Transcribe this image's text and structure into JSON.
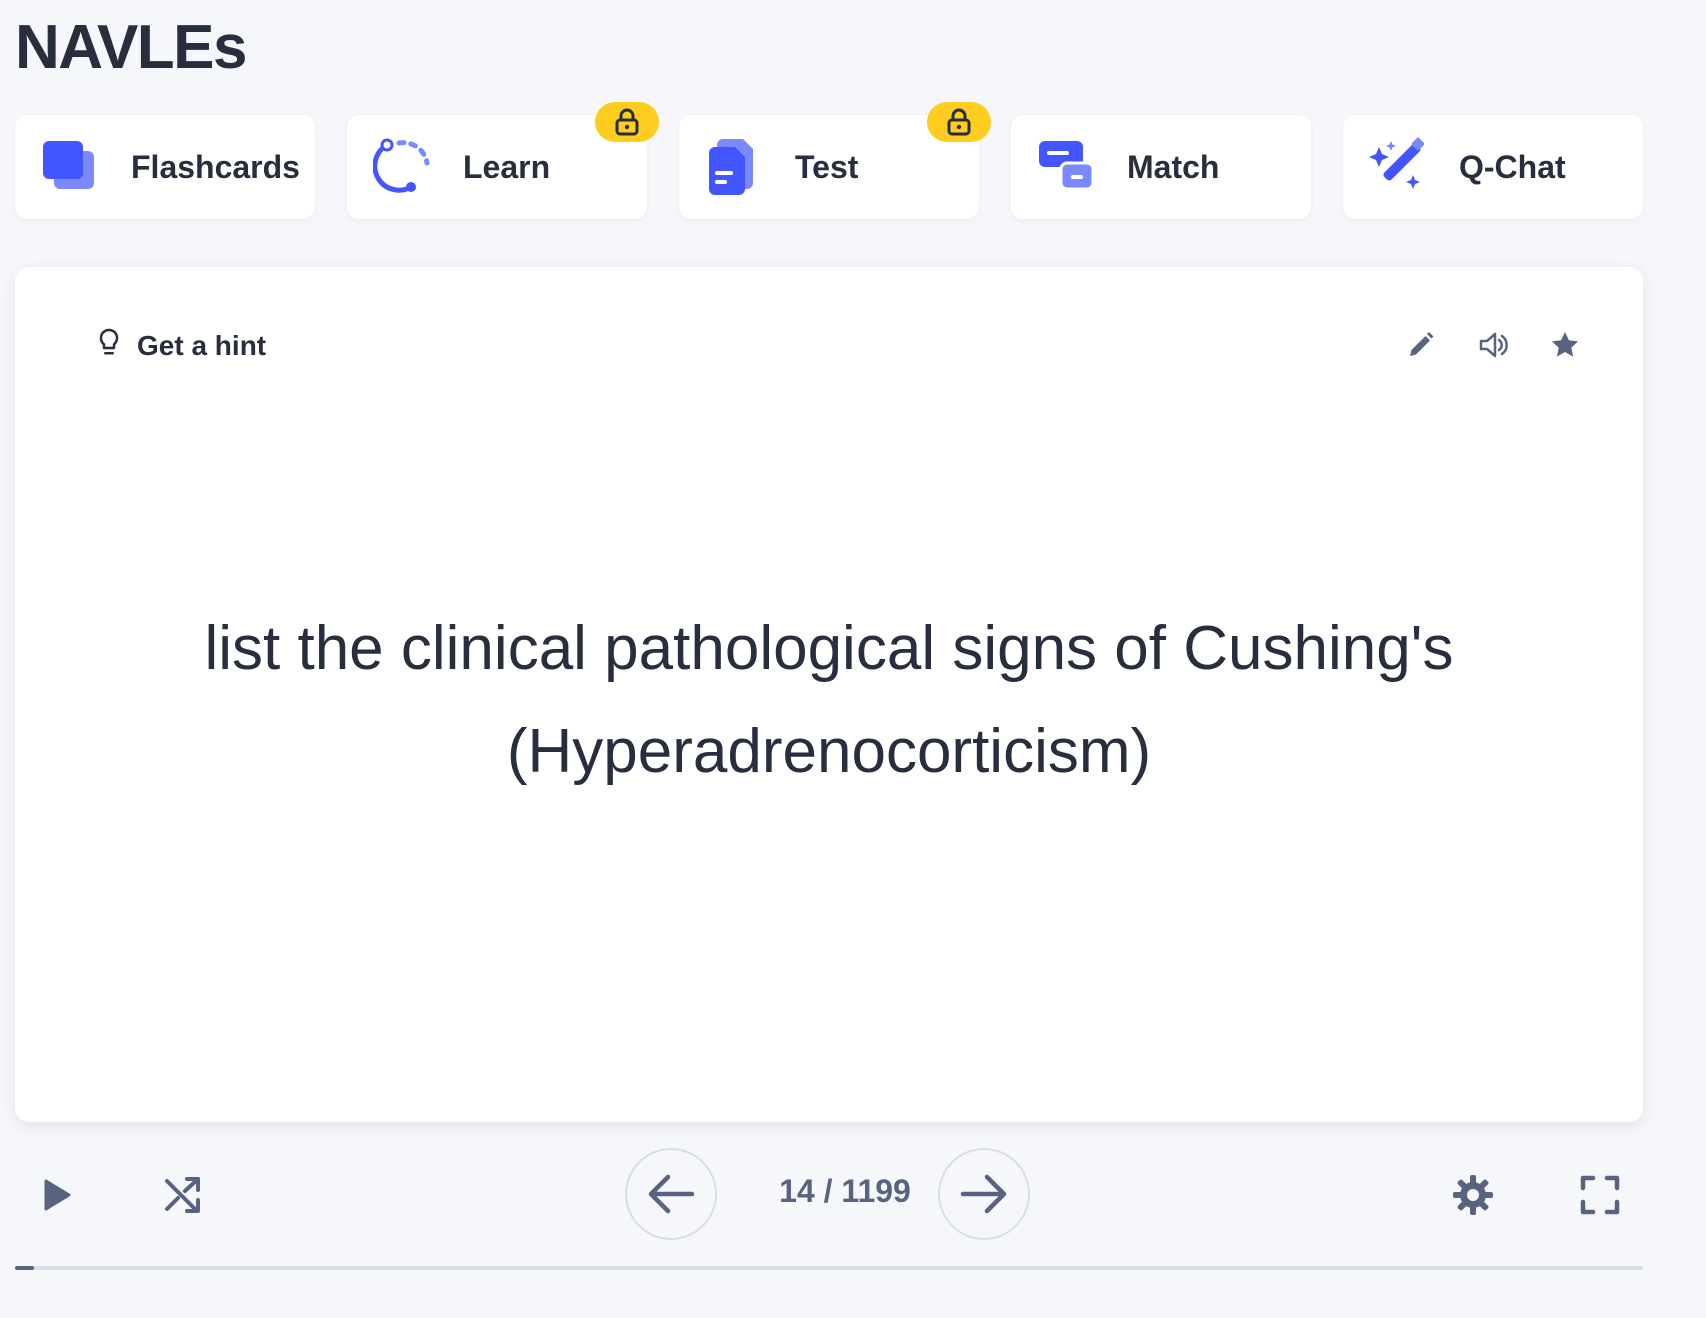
{
  "set": {
    "title": "NAVLEs"
  },
  "modes": [
    {
      "label": "Flashcards",
      "icon": "flashcards-icon",
      "locked": false
    },
    {
      "label": "Learn",
      "icon": "learn-icon",
      "locked": true
    },
    {
      "label": "Test",
      "icon": "test-icon",
      "locked": true
    },
    {
      "label": "Match",
      "icon": "match-icon",
      "locked": false
    },
    {
      "label": "Q-Chat",
      "icon": "magic-wand-icon",
      "locked": false
    }
  ],
  "card": {
    "hint_label": "Get a hint",
    "term": "list the clinical pathological signs of Cushing's (Hyperadrenocorticism)",
    "tools": [
      "edit-icon",
      "audio-icon",
      "star-icon"
    ]
  },
  "controls": {
    "counter": "14 / 1199",
    "current": 14,
    "total": 1199
  },
  "colors": {
    "accent": "#4255ff",
    "accent_light": "#7b89ff",
    "lock_badge": "#ffcd1f",
    "text": "#282e3e",
    "muted": "#586380",
    "background": "#f6f7fb"
  }
}
